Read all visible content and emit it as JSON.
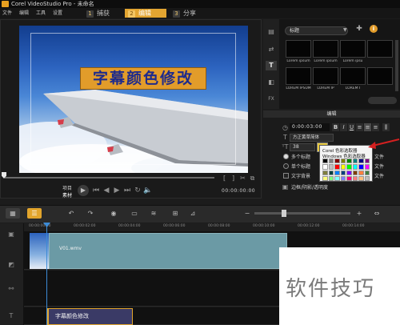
{
  "window": {
    "title": "Corel VideoStudio Pro - 未命名"
  },
  "menu": [
    "文件",
    "编辑",
    "工具",
    "设置"
  ],
  "steps": [
    {
      "num": "1",
      "label": "捕获"
    },
    {
      "num": "2",
      "label": "编辑"
    },
    {
      "num": "3",
      "label": "分享"
    }
  ],
  "preview": {
    "caption": "字幕颜色修改",
    "mode_project": "项目",
    "mode_clip": "素材",
    "timecode": "00:00:00:00"
  },
  "library": {
    "category": "标题",
    "thumb_labels": [
      "Lorem ipsum",
      "Lorem ipsum",
      "Lorem ipsu",
      "",
      "LOREM IPSUM",
      "LOREM IP",
      "LOREM I",
      ""
    ]
  },
  "edit": {
    "header": "编辑",
    "duration": "0:00:03:00",
    "font": "方正黄草简体",
    "size": "38",
    "multi_title": "多个标题",
    "single_title": "单个标题",
    "text_bg": "文字背景",
    "border_label": "边框/阴影/透明度",
    "side_labels": [
      "文件",
      "文件",
      "文件"
    ]
  },
  "color_popup": {
    "corel_picker": "Corel 色彩选取器",
    "windows_picker": "Windows 色彩选取器",
    "palette": [
      "#000000",
      "#7f7f7f",
      "#7f0000",
      "#7f7f00",
      "#007f00",
      "#007f7f",
      "#00007f",
      "#7f007f",
      "#ffffff",
      "#c0c0c0",
      "#ff0000",
      "#ffff00",
      "#00ff00",
      "#00ffff",
      "#0000ff",
      "#ff00ff",
      "#7f7f3f",
      "#003f3f",
      "#007fff",
      "#003f7f",
      "#7f00ff",
      "#7f3f00",
      "#ff7f3f",
      "#3f7f3f",
      "#ffff7f",
      "#7fff7f",
      "#7fffff",
      "#7f7fff",
      "#ff007f",
      "#ff7f7f",
      "#ffbf7f",
      "#bfbfbf"
    ]
  },
  "timeline": {
    "ticks": [
      "00:00:00:00",
      "00:00:02:00",
      "00:00:04:00",
      "00:00:06:00",
      "00:00:08:00",
      "00:00:10:00",
      "00:00:12:00",
      "00:00:14:00"
    ],
    "video_clip": "V01.wmv",
    "title_clip": "字幕颜色修改"
  },
  "watermark": "软件技巧"
}
